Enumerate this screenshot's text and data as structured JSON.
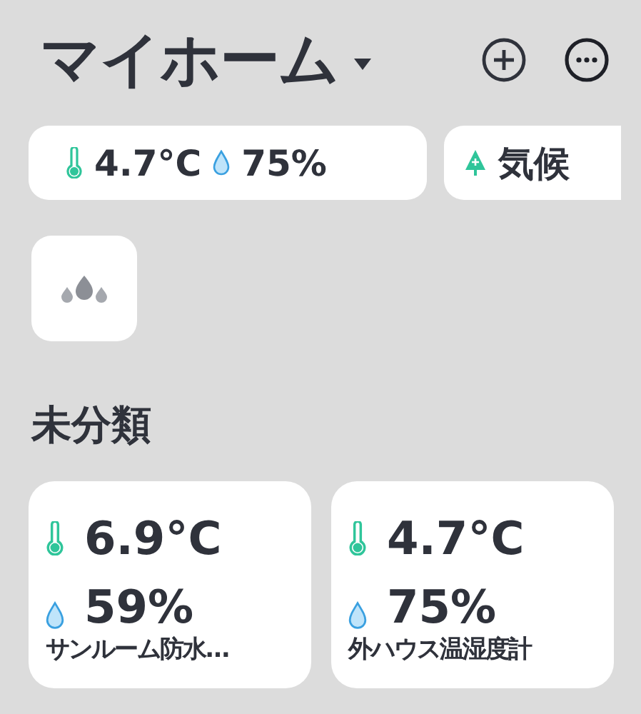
{
  "header": {
    "title": "マイホーム"
  },
  "summary": {
    "temperature": "4.7°C",
    "humidity": "75%"
  },
  "weather": {
    "label": "気候"
  },
  "section": {
    "title": "未分類"
  },
  "devices": [
    {
      "temperature": "6.9°C",
      "humidity": "59%",
      "name": "サンルーム防水…"
    },
    {
      "temperature": "4.7°C",
      "humidity": "75%",
      "name": "外ハウス温湿度計"
    }
  ]
}
